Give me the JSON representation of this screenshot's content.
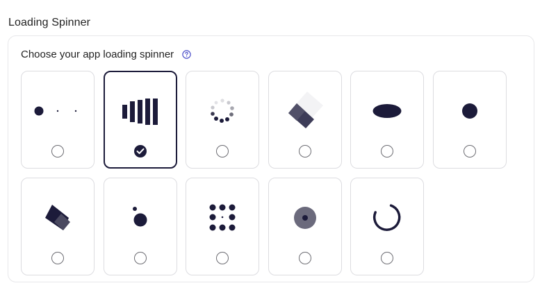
{
  "section": {
    "title": "Loading Spinner"
  },
  "panel": {
    "label": "Choose your app loading spinner",
    "help_icon": "question-circle-icon"
  },
  "colors": {
    "accent": "#1c1b3a",
    "border": "#dcdce0",
    "muted": "#6c6c72"
  },
  "spinners": [
    {
      "name": "dots-fade",
      "selected": false
    },
    {
      "name": "bars",
      "selected": true
    },
    {
      "name": "circle-dots",
      "selected": false
    },
    {
      "name": "flipping-squares",
      "selected": false
    },
    {
      "name": "pulsing-ellipse",
      "selected": false
    },
    {
      "name": "pulsing-dot",
      "selected": false
    },
    {
      "name": "rotating-squares",
      "selected": false
    },
    {
      "name": "orbit-dot",
      "selected": false
    },
    {
      "name": "dot-grid",
      "selected": false
    },
    {
      "name": "ring-dot",
      "selected": false
    },
    {
      "name": "arc-spinner",
      "selected": false
    }
  ]
}
